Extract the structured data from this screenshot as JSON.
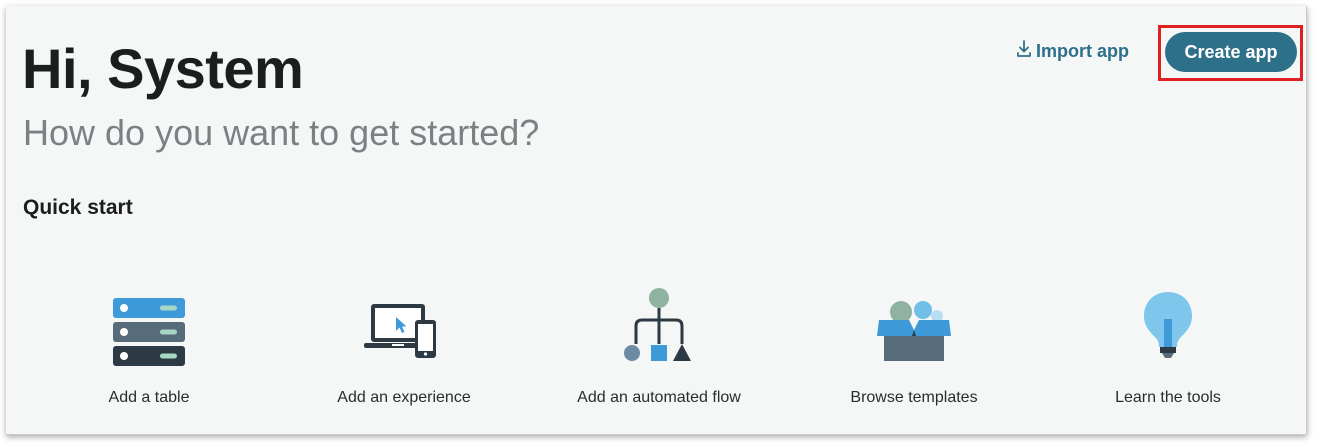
{
  "header": {
    "greeting": "Hi, System",
    "subtitle": "How do you want to get started?",
    "import_label": "Import app",
    "create_label": "Create app"
  },
  "quick_start": {
    "title": "Quick start",
    "items": [
      {
        "label": "Add a table",
        "icon": "database-icon"
      },
      {
        "label": "Add an experience",
        "icon": "devices-icon"
      },
      {
        "label": "Add an automated flow",
        "icon": "flow-icon"
      },
      {
        "label": "Browse templates",
        "icon": "templates-box-icon"
      },
      {
        "label": "Learn the tools",
        "icon": "lightbulb-icon"
      }
    ]
  },
  "colors": {
    "accent": "#2e7089",
    "highlight": "#e02020",
    "background": "#f5f6f6"
  }
}
